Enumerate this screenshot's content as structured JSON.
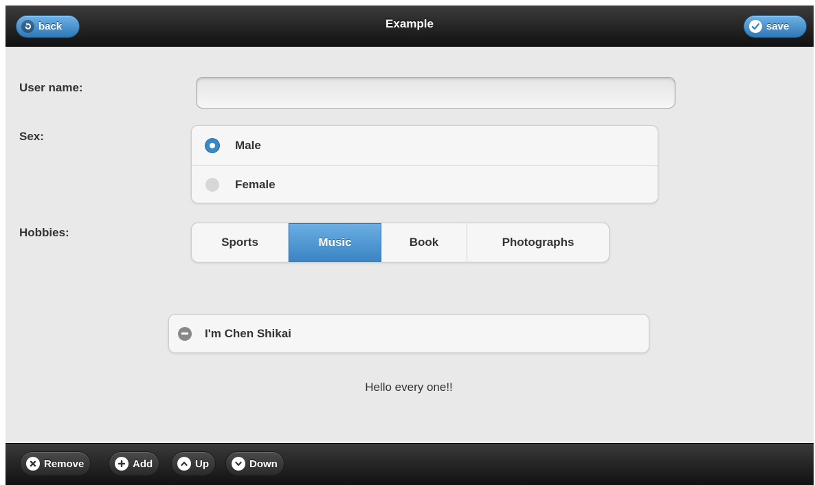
{
  "header": {
    "title": "Example",
    "back_label": "back",
    "save_label": "save",
    "accent_color": "#3a88c5"
  },
  "form": {
    "username_label": "User name:",
    "username_value": "",
    "sex_label": "Sex:",
    "sex_options": [
      {
        "label": "Male",
        "selected": true
      },
      {
        "label": "Female",
        "selected": false
      }
    ],
    "hobbies_label": "Hobbies:",
    "hobbies": [
      {
        "label": "Sports",
        "selected": false
      },
      {
        "label": "Music",
        "selected": true
      },
      {
        "label": "Book",
        "selected": false
      },
      {
        "label": "Photographs",
        "selected": false
      }
    ]
  },
  "collapsible": {
    "heading": "I'm Chen Shikai",
    "expanded": true,
    "content": "Hello every one!!"
  },
  "footer": {
    "buttons": [
      {
        "label": "Remove",
        "icon": "close-icon"
      },
      {
        "label": "Add",
        "icon": "plus-icon"
      },
      {
        "label": "Up",
        "icon": "chevron-up-icon"
      },
      {
        "label": "Down",
        "icon": "chevron-down-icon"
      }
    ]
  }
}
